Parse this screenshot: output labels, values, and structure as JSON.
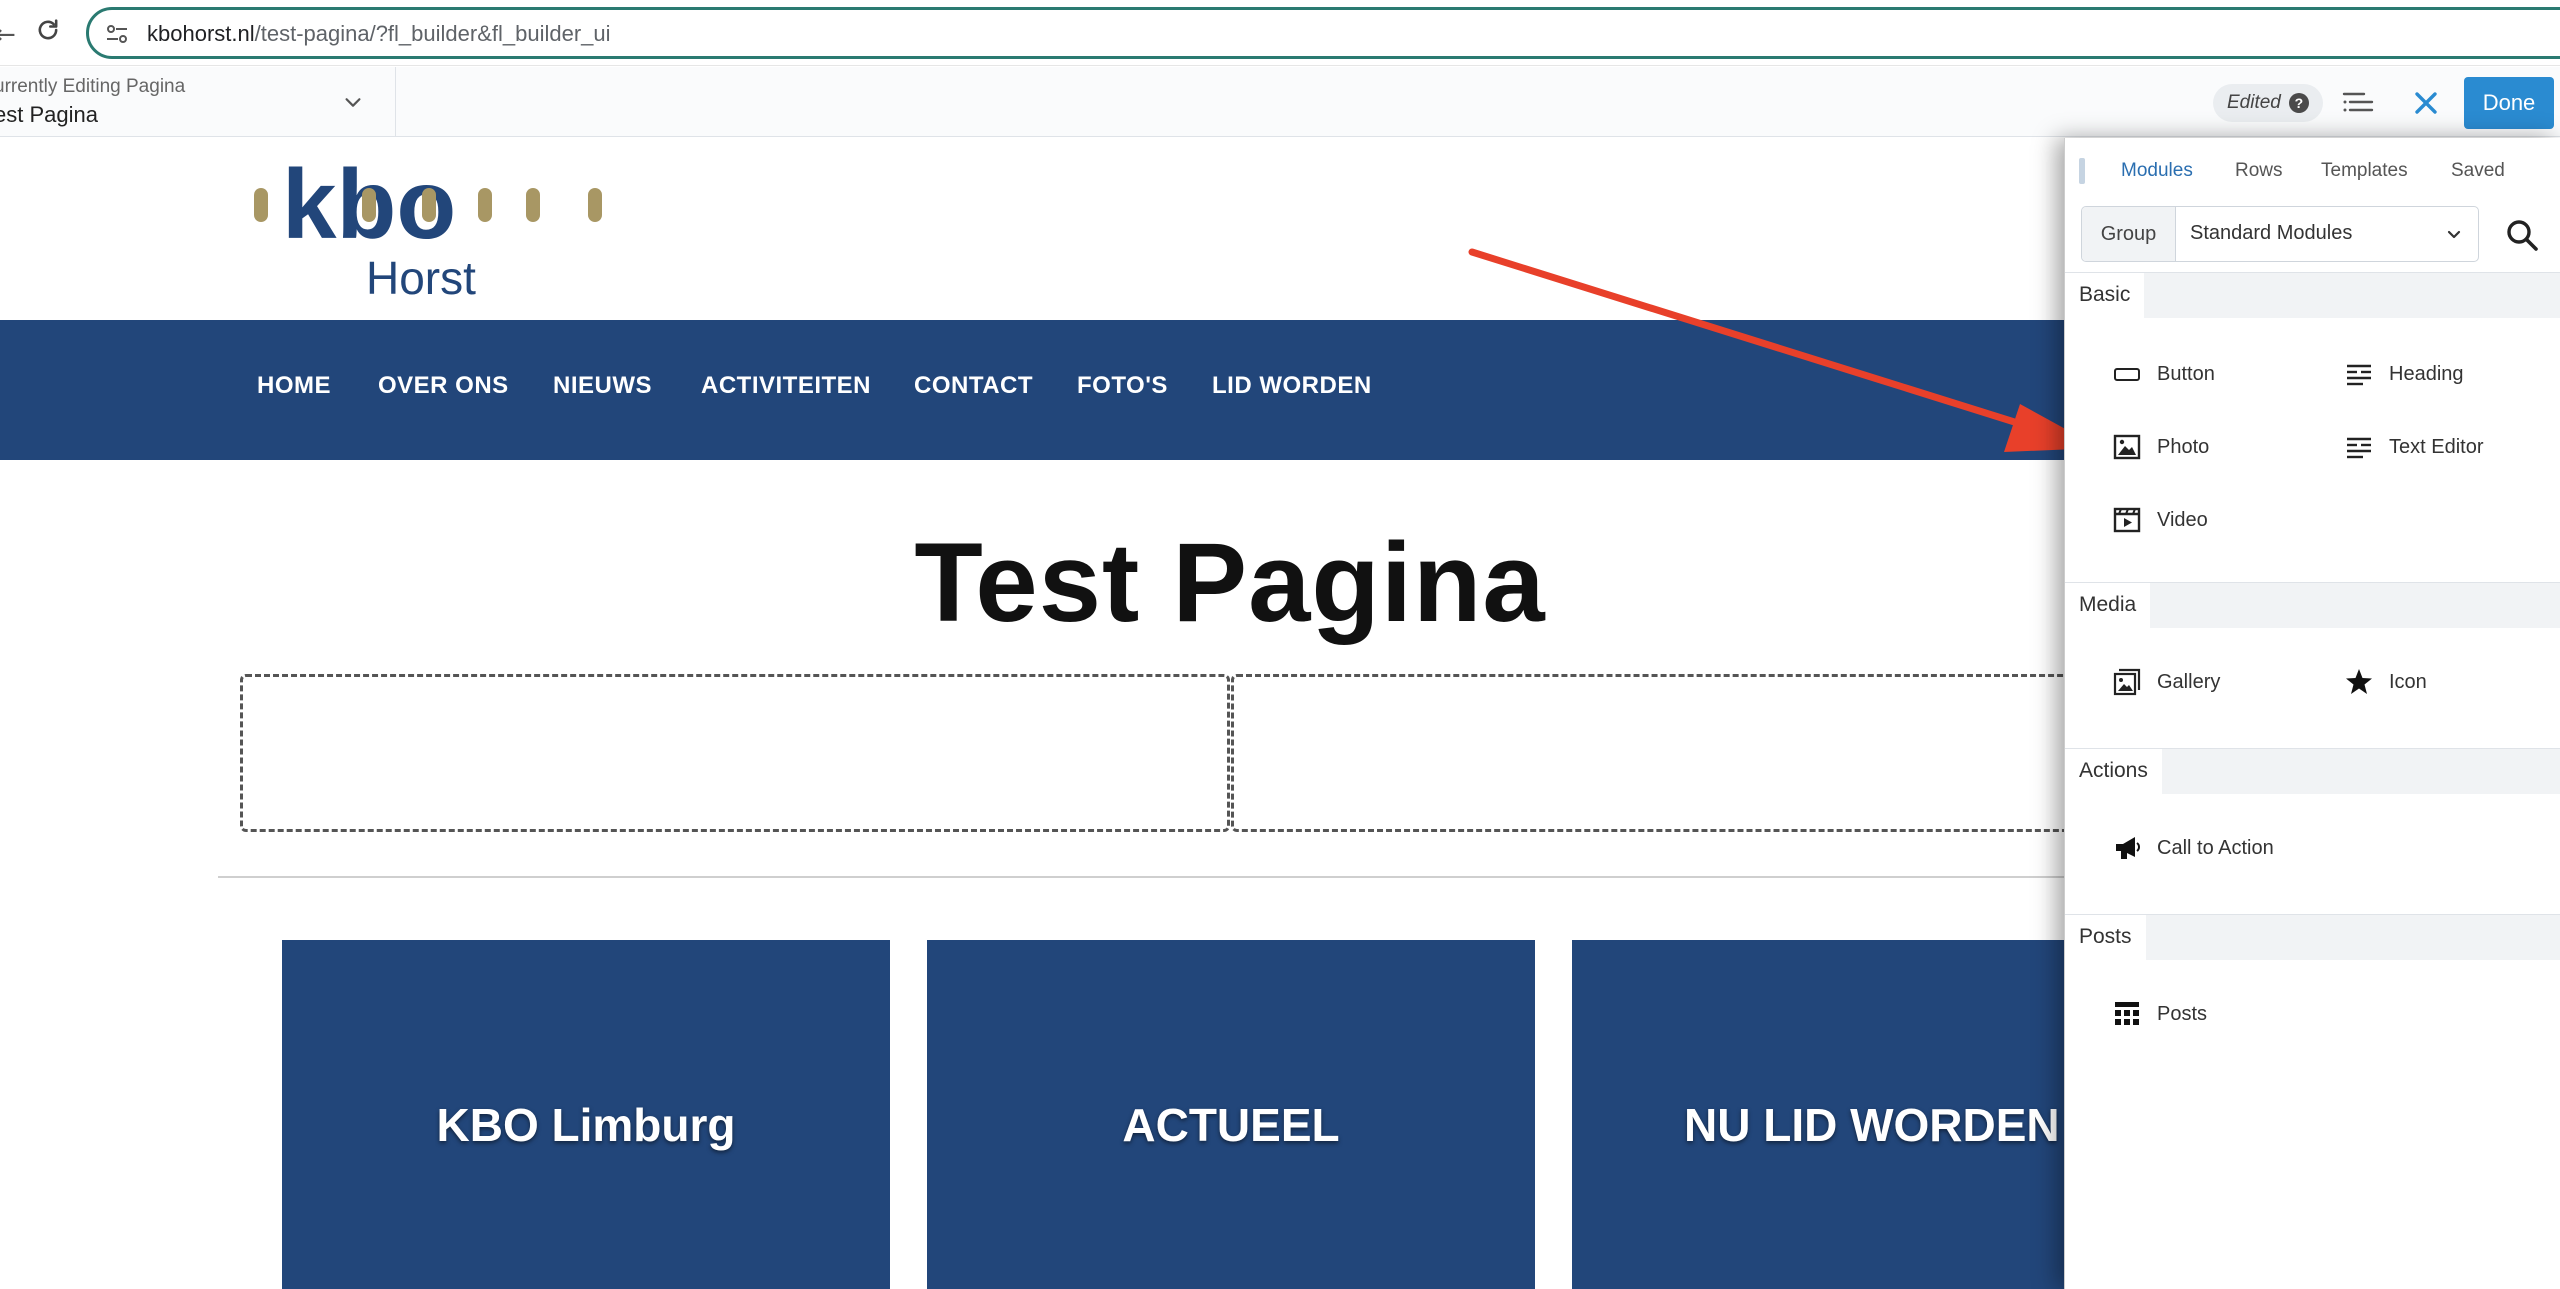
{
  "browser": {
    "url_host": "kbohorst.nl",
    "url_path": "/test-pagina/?fl_builder&fl_builder_ui"
  },
  "builder": {
    "editing_label": "urrently Editing Pagina",
    "editing_title": "est Pagina",
    "edited_label": "Edited",
    "help_glyph": "?",
    "done_label": "Done"
  },
  "site": {
    "logo_text_top": "kbo",
    "logo_text_bottom": "Horst",
    "nav": [
      "HOME",
      "OVER ONS",
      "NIEUWS",
      "ACTIVITEITEN",
      "CONTACT",
      "FOTO'S",
      "LID WORDEN"
    ],
    "page_title": "Test Pagina",
    "tiles": [
      "KBO Limburg",
      "ACTUEEL",
      "NU LID WORDEN"
    ]
  },
  "panel": {
    "tabs": [
      "Modules",
      "Rows",
      "Templates",
      "Saved"
    ],
    "active_tab": "Modules",
    "group_label": "Group",
    "group_value": "Standard Modules",
    "sections": [
      {
        "title": "Basic",
        "modules": [
          {
            "label": "Button",
            "icon": "button-icon"
          },
          {
            "label": "Heading",
            "icon": "heading-icon"
          },
          {
            "label": "Photo",
            "icon": "photo-icon"
          },
          {
            "label": "Text Editor",
            "icon": "text-editor-icon"
          },
          {
            "label": "Video",
            "icon": "video-icon"
          }
        ]
      },
      {
        "title": "Media",
        "modules": [
          {
            "label": "Gallery",
            "icon": "gallery-icon"
          },
          {
            "label": "Icon",
            "icon": "star-icon"
          }
        ]
      },
      {
        "title": "Actions",
        "modules": [
          {
            "label": "Call to Action",
            "icon": "megaphone-icon"
          }
        ]
      },
      {
        "title": "Posts",
        "modules": [
          {
            "label": "Posts",
            "icon": "posts-grid-icon"
          }
        ]
      }
    ]
  },
  "colors": {
    "nav_blue": "#22467a",
    "accent_blue": "#2a8bd1",
    "logo_gold": "#a89764",
    "annotation_red": "#e8402a"
  }
}
